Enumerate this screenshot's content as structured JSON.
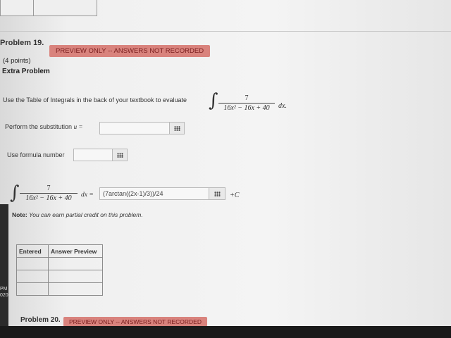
{
  "problem19": {
    "title": "Problem 19.",
    "badge": "PREVIEW ONLY -- ANSWERS NOT RECORDED",
    "points": "(4 points)",
    "heading": "Extra Problem",
    "instruction": "Use the Table of Integrals in the back of your textbook to evaluate",
    "integrand_numerator": "7",
    "integrand_denominator": "16x² − 16x + 40",
    "differential": "dx.",
    "substitution_label": "Perform the substitution",
    "substitution_var": "u =",
    "substitution_value": "",
    "formula_label": "Use formula number",
    "formula_value": "",
    "answer_differential": "dx =",
    "answer_value": "(7arctan((2x-1)/3))/24",
    "plus_c": "+C",
    "note_label": "Note:",
    "note_text": "You can earn partial credit on this problem."
  },
  "preview_table": {
    "headers": [
      "Entered",
      "Answer Preview"
    ],
    "rows": [
      [
        "",
        ""
      ],
      [
        "",
        ""
      ],
      [
        "",
        ""
      ]
    ]
  },
  "problem20": {
    "title": "Problem 20.",
    "badge": "PREVIEW ONLY -- ANSWERS NOT RECORDED"
  },
  "taskbar": {
    "time_suffix": "PM",
    "year_fragment": "020"
  },
  "colors": {
    "badge_bg": "#d9837d",
    "badge_text": "#7a1e1e"
  }
}
